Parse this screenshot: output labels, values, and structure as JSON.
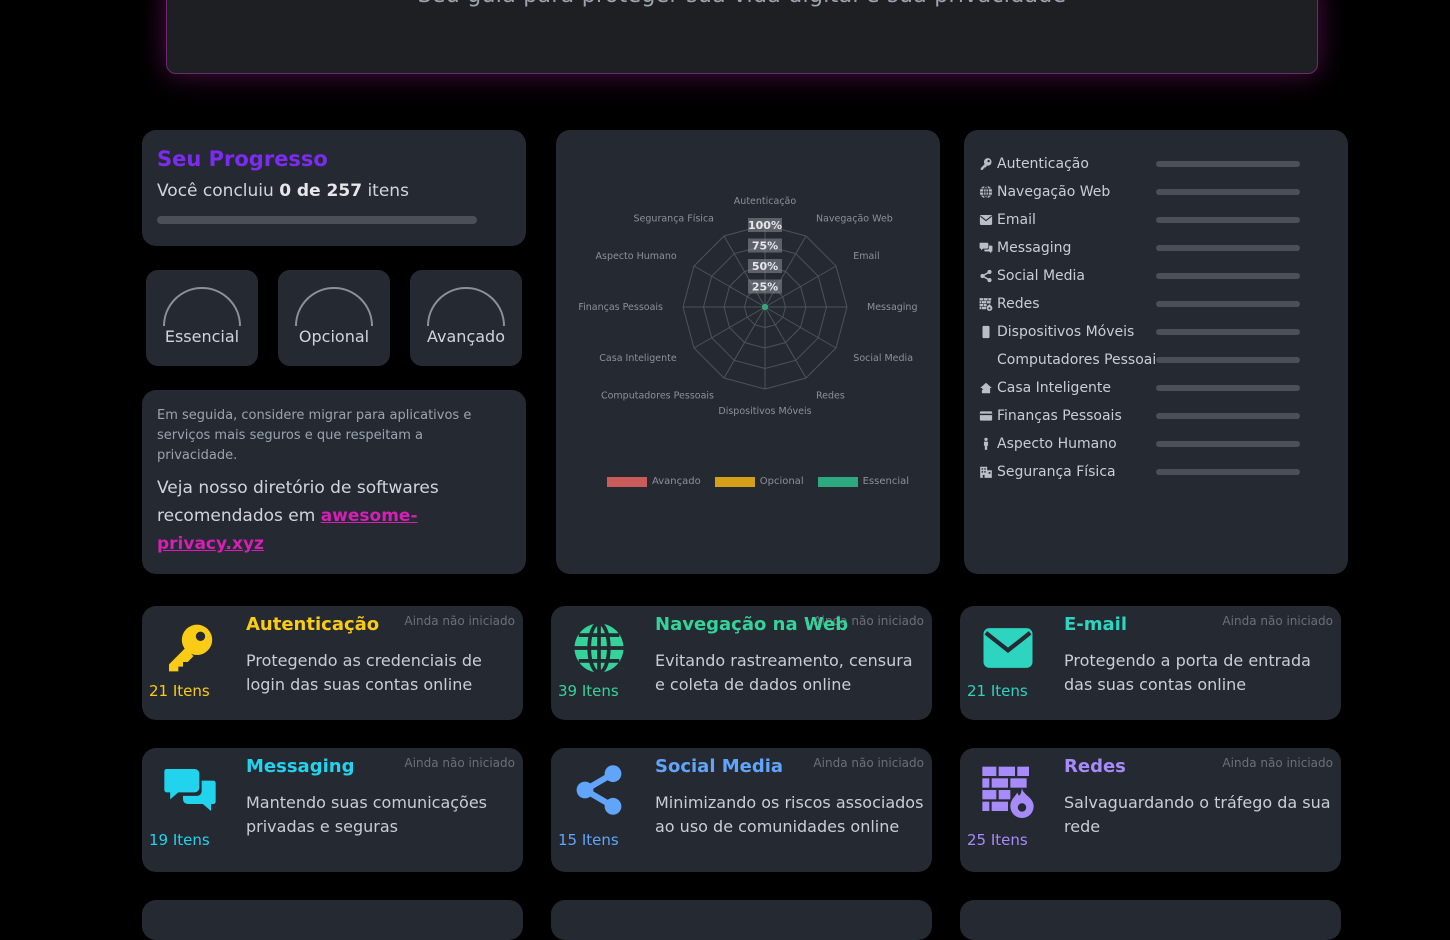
{
  "hero": {
    "subtitle": "Seu guia para proteger sua vida digital e sua privacidade"
  },
  "progress": {
    "title": "Seu Progresso",
    "text_before": "Você concluiu ",
    "count_text": "0 de 257",
    "text_after": " itens",
    "completed": 0,
    "total": 257,
    "fraction": 0
  },
  "gauges": [
    {
      "label": "Essencial",
      "fraction": 0
    },
    {
      "label": "Opcional",
      "fraction": 0
    },
    {
      "label": "Avançado",
      "fraction": 0
    }
  ],
  "migration": {
    "small_text": "Em seguida, considere migrar para aplicativos e serviços mais seguros e que respeitam a privacidade.",
    "big_text": "Veja nosso diretório de softwares recomendados em ",
    "link_text": "awesome-privacy.xyz"
  },
  "chart_data": {
    "type": "radar",
    "categories": [
      "Autenticação",
      "Navegação Web",
      "Email",
      "Messaging",
      "Social Media",
      "Redes",
      "Dispositivos Móveis",
      "Computadores Pessoais",
      "Casa Inteligente",
      "Finanças Pessoais",
      "Aspecto Humano",
      "Segurança Física"
    ],
    "tick_labels": [
      "25%",
      "50%",
      "75%",
      "100%"
    ],
    "rmax": 100,
    "series": [
      {
        "name": "Avançado",
        "color": "#c95b5b",
        "values": [
          0,
          0,
          0,
          0,
          0,
          0,
          0,
          0,
          0,
          0,
          0,
          0
        ]
      },
      {
        "name": "Opcional",
        "color": "#d4a017",
        "values": [
          0,
          0,
          0,
          0,
          0,
          0,
          0,
          0,
          0,
          0,
          0,
          0
        ]
      },
      {
        "name": "Essencial",
        "color": "#2ea87e",
        "values": [
          0,
          0,
          0,
          0,
          0,
          0,
          0,
          0,
          0,
          0,
          0,
          0
        ]
      }
    ],
    "legend_position": "bottom"
  },
  "category_progress": [
    {
      "label": "Autenticação",
      "icon": "key-icon",
      "fraction": 0
    },
    {
      "label": "Navegação Web",
      "icon": "globe-icon",
      "fraction": 0
    },
    {
      "label": "Email",
      "icon": "envelope-icon",
      "fraction": 0
    },
    {
      "label": "Messaging",
      "icon": "chat-icon",
      "fraction": 0
    },
    {
      "label": "Social Media",
      "icon": "share-icon",
      "fraction": 0
    },
    {
      "label": "Redes",
      "icon": "firewall-icon",
      "fraction": 0
    },
    {
      "label": "Dispositivos Móveis",
      "icon": "phone-icon",
      "fraction": 0
    },
    {
      "label": "Computadores Pessoais",
      "icon": "",
      "fraction": 0
    },
    {
      "label": "Casa Inteligente",
      "icon": "house-icon",
      "fraction": 0
    },
    {
      "label": "Finanças Pessoais",
      "icon": "card-icon",
      "fraction": 0
    },
    {
      "label": "Aspecto Humano",
      "icon": "person-icon",
      "fraction": 0
    },
    {
      "label": "Segurança Física",
      "icon": "building-icon",
      "fraction": 0
    }
  ],
  "tiles": [
    {
      "title": "Autenticação",
      "count": "21 Itens",
      "status": "Ainda não iniciado",
      "description": "Protegendo as credenciais de login das suas contas online",
      "color": "#facc15",
      "icon": "key-icon"
    },
    {
      "title": "Navegação na Web",
      "count": "39 Itens",
      "status": "Ainda não iniciado",
      "description": "Evitando rastreamento, censura e coleta de dados online",
      "color": "#34d399",
      "icon": "globe-icon"
    },
    {
      "title": "E-mail",
      "count": "21 Itens",
      "status": "Ainda não iniciado",
      "description": "Protegendo a porta de entrada das suas contas online",
      "color": "#2dd4bf",
      "icon": "envelope-icon"
    },
    {
      "title": "Messaging",
      "count": "19 Itens",
      "status": "Ainda não iniciado",
      "description": "Mantendo suas comunicações privadas e seguras",
      "color": "#22d3ee",
      "icon": "chat-icon"
    },
    {
      "title": "Social Media",
      "count": "15 Itens",
      "status": "Ainda não iniciado",
      "description": "Minimizando os riscos associados ao uso de comunidades online",
      "color": "#60a5fa",
      "icon": "share-icon"
    },
    {
      "title": "Redes",
      "count": "25 Itens",
      "status": "Ainda não iniciado",
      "description": "Salvaguardando o tráfego da sua rede",
      "color": "#a78bfa",
      "icon": "firewall-icon"
    }
  ]
}
